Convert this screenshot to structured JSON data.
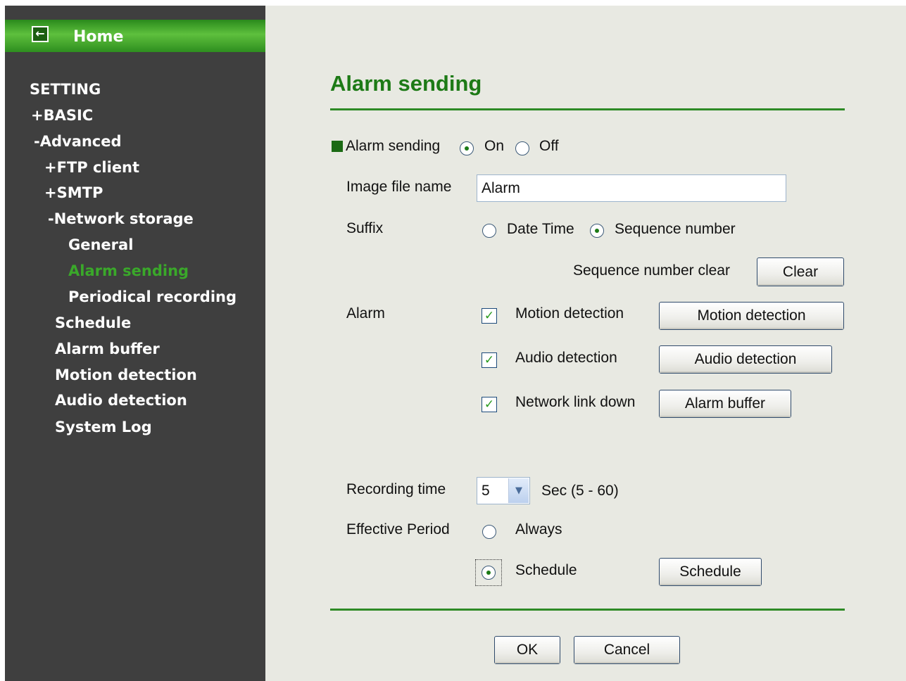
{
  "sidebar": {
    "home_label": "Home",
    "home_icon": "back-arrow-icon",
    "items": [
      {
        "label": "SETTING"
      },
      {
        "label": "+BASIC"
      },
      {
        "label": "-Advanced"
      },
      {
        "label": "+FTP client"
      },
      {
        "label": "+SMTP"
      },
      {
        "label": "-Network storage"
      },
      {
        "label": "General"
      },
      {
        "label": "Alarm sending",
        "active": true
      },
      {
        "label": "Periodical recording"
      },
      {
        "label": "Schedule"
      },
      {
        "label": "Alarm buffer"
      },
      {
        "label": "Motion detection"
      },
      {
        "label": "Audio detection"
      },
      {
        "label": "System Log"
      }
    ]
  },
  "main": {
    "title": "Alarm sending",
    "alarm_sending": {
      "label": "Alarm sending",
      "on_label": "On",
      "off_label": "Off",
      "selected": "On"
    },
    "image_file_name": {
      "label": "Image file name",
      "value": "Alarm"
    },
    "suffix": {
      "label": "Suffix",
      "option_date": "Date Time",
      "option_seq": "Sequence number",
      "selected": "Sequence number"
    },
    "sequence_clear": {
      "label": "Sequence number clear",
      "button": "Clear"
    },
    "alarm": {
      "label": "Alarm",
      "items": [
        {
          "label": "Motion detection",
          "checked": true,
          "button": "Motion detection"
        },
        {
          "label": "Audio detection",
          "checked": true,
          "button": "Audio detection"
        },
        {
          "label": "Network link down",
          "checked": true,
          "button": "Alarm buffer"
        }
      ]
    },
    "recording_time": {
      "label": "Recording time",
      "value": "5",
      "unit": "Sec (5 - 60)"
    },
    "effective_period": {
      "label": "Effective Period",
      "option_always": "Always",
      "option_schedule": "Schedule",
      "selected": "Schedule",
      "schedule_button": "Schedule"
    },
    "ok_button": "OK",
    "cancel_button": "Cancel"
  },
  "colors": {
    "accent_green": "#1d7a16",
    "sidebar_bg": "#3f3f3f",
    "active_nav": "#3aa82a",
    "panel_bg": "#e8e9e2"
  }
}
